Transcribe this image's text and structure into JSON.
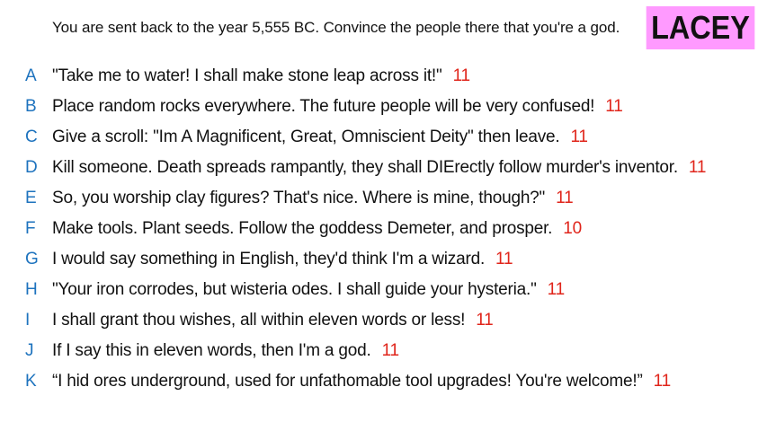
{
  "prompt": "You are sent back to the year 5,555 BC. Convince the people there that you're a god.",
  "name": "LACEY",
  "colors": {
    "letter": "#1e73be",
    "count": "#e0251b",
    "badge": "#ff9aff",
    "text": "#111111"
  },
  "answers": [
    {
      "letter": "A",
      "text": "\"Take me to water! I shall make stone leap across it!\"",
      "count": "11"
    },
    {
      "letter": "B",
      "text": "Place random rocks everywhere. The future people will be very confused!",
      "count": "11"
    },
    {
      "letter": "C",
      "text": "Give a scroll: \"Im A Magnificent, Great, Omniscient Deity\" then leave.",
      "count": "11"
    },
    {
      "letter": "D",
      "text": "Kill someone. Death spreads rampantly, they shall DIErectly follow murder's inventor.",
      "count": "11"
    },
    {
      "letter": "E",
      "text": "So, you worship clay figures? That's nice. Where is mine, though?\"",
      "count": "11"
    },
    {
      "letter": "F",
      "text": "Make tools. Plant seeds. Follow the goddess Demeter, and prosper.",
      "count": "10"
    },
    {
      "letter": "G",
      "text": "I would say something in English, they'd think I'm a wizard.",
      "count": "11"
    },
    {
      "letter": "H",
      "text": "\"Your iron corrodes, but wisteria odes. I shall guide your hysteria.\"",
      "count": "11"
    },
    {
      "letter": "I",
      "text": "I shall grant thou wishes, all within eleven words or less!",
      "count": "11"
    },
    {
      "letter": "J",
      "text": "If I say this in eleven words, then I'm a god.",
      "count": "11"
    },
    {
      "letter": "K",
      "text": "“I hid ores underground, used for unfathomable tool upgrades! You're welcome!”",
      "count": "11"
    }
  ]
}
